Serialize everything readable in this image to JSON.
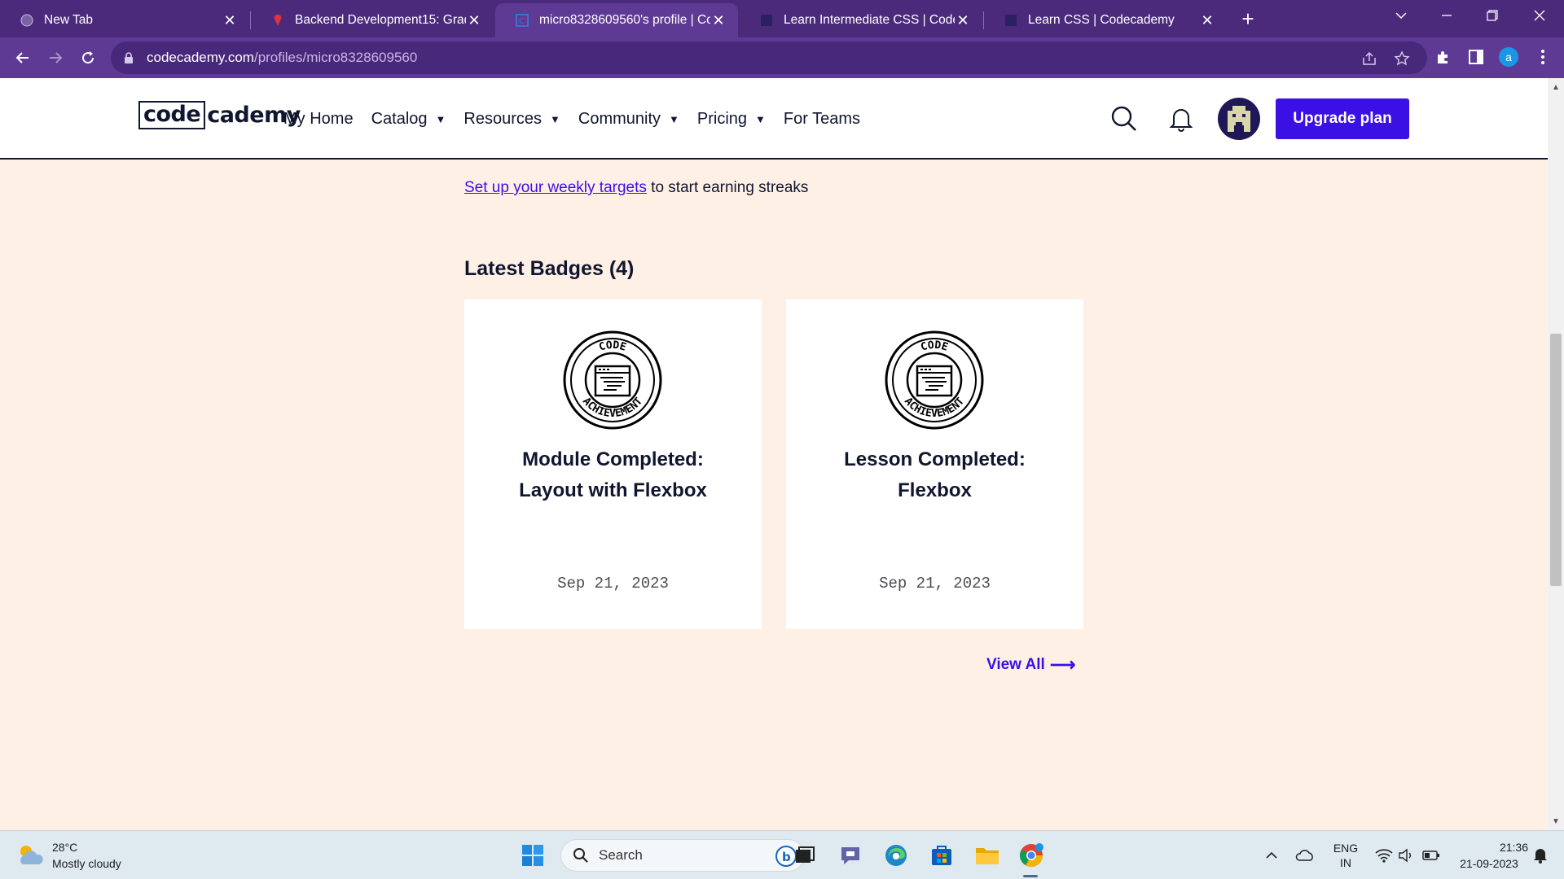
{
  "browser": {
    "tabs": [
      {
        "title": "New Tab",
        "active": false
      },
      {
        "title": "Backend Development15: Graded",
        "active": false
      },
      {
        "title": "micro8328609560's profile | Code",
        "active": true
      },
      {
        "title": "Learn Intermediate CSS | Codecad",
        "active": false
      },
      {
        "title": "Learn CSS | Codecademy",
        "active": false
      }
    ],
    "close_glyph": "✕",
    "new_tab_glyph": "+",
    "url_host": "codecademy.com",
    "url_path": "/profiles/micro8328609560",
    "profile_initial": "a"
  },
  "site": {
    "logo_box": "code",
    "logo_rest": "cademy",
    "nav": [
      {
        "label": "My Home",
        "dropdown": false
      },
      {
        "label": "Catalog",
        "dropdown": true
      },
      {
        "label": "Resources",
        "dropdown": true
      },
      {
        "label": "Community",
        "dropdown": true
      },
      {
        "label": "Pricing",
        "dropdown": true
      },
      {
        "label": "For Teams",
        "dropdown": false
      }
    ],
    "caret": "▼",
    "upgrade_label": "Upgrade plan"
  },
  "profile": {
    "targets_link": "Set up your weekly targets",
    "targets_rest": " to start earning streaks",
    "badges_title": "Latest Badges (4)",
    "badges": [
      {
        "name_line1": "Module Completed:",
        "name_line2": "Layout with Flexbox",
        "date": "Sep 21, 2023",
        "badge_top": "CODE",
        "badge_bottom": "ACHIEVEMENT"
      },
      {
        "name_line1": "Lesson Completed:",
        "name_line2": "Flexbox",
        "date": "Sep 21, 2023",
        "badge_top": "CODE",
        "badge_bottom": "ACHIEVEMENT"
      }
    ],
    "view_all": "View All",
    "view_all_arrow": "⟶"
  },
  "taskbar": {
    "temp": "28°C",
    "condition": "Mostly cloudy",
    "search_label": "Search",
    "lang_line1": "ENG",
    "lang_line2": "IN",
    "time": "21:36",
    "date": "21-09-2023"
  },
  "colors": {
    "browser_frame": "#4b2a7c",
    "accent": "#3a10e5",
    "page_bg": "#fff0e5",
    "navy": "#10162f"
  }
}
